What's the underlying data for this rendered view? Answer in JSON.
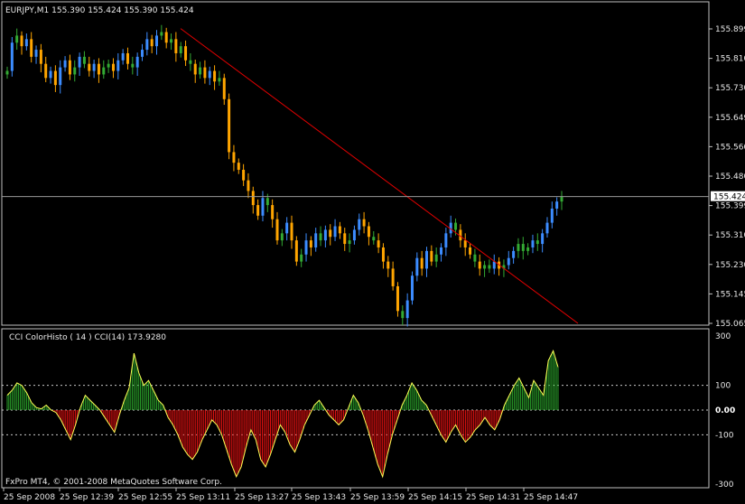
{
  "window": {
    "symbol_caption": "EURJPY,M1  155.390 155.424 155.390 155.424",
    "indicator_caption": "CCI ColorHisto ( 14 )   CCI(14) 173.9280",
    "copyright": "FxPro MT4, © 2001-2008 MetaQuotes Software Corp."
  },
  "colors": {
    "background": "#000000",
    "frame": "#c0c0c0",
    "bull_candle": "#3c8cff",
    "bear_candle": "#ffa500",
    "neutral_bar": "#33aa33",
    "trend_line": "#e00000",
    "cci_line": "#ffff55",
    "cci_pos_histo": "#2aa02a",
    "cci_neg_histo": "#e01010",
    "current_price_line": "#9a9a9a"
  },
  "chart_data": [
    {
      "type": "candlestick",
      "title": "EURJPY,M1",
      "price_labels": [
        "155.899",
        "155.810",
        "155.730",
        "155.649",
        "155.560",
        "155.480",
        "155.399",
        "155.310",
        "155.230",
        "155.145",
        "155.065"
      ],
      "current_price_label": "155.424",
      "ylim": [
        155.065,
        155.899
      ],
      "current_price": 155.424,
      "trend_line": {
        "from_time": "13:12",
        "from_price": 155.9,
        "to_time": "14:58",
        "to_price": 155.065
      },
      "series_close": [
        155.78,
        155.86,
        155.88,
        155.85,
        155.87,
        155.82,
        155.84,
        155.8,
        155.76,
        155.78,
        155.74,
        155.79,
        155.81,
        155.77,
        155.79,
        155.82,
        155.8,
        155.78,
        155.8,
        155.77,
        155.79,
        155.8,
        155.78,
        155.81,
        155.83,
        155.8,
        155.79,
        155.82,
        155.84,
        155.87,
        155.85,
        155.88,
        155.89,
        155.86,
        155.87,
        155.83,
        155.85,
        155.81,
        155.8,
        155.77,
        155.79,
        155.76,
        155.78,
        155.75,
        155.76,
        155.7,
        155.55,
        155.52,
        155.5,
        155.47,
        155.44,
        155.4,
        155.37,
        155.42,
        155.4,
        155.36,
        155.3,
        155.32,
        155.35,
        155.3,
        155.24,
        155.26,
        155.3,
        155.28,
        155.32,
        155.3,
        155.33,
        155.31,
        155.34,
        155.32,
        155.29,
        155.3,
        155.33,
        155.36,
        155.34,
        155.31,
        155.3,
        155.28,
        155.24,
        155.22,
        155.17,
        155.1,
        155.08,
        155.13,
        155.2,
        155.25,
        155.22,
        155.27,
        155.24,
        155.26,
        155.28,
        155.32,
        155.35,
        155.33,
        155.3,
        155.28,
        155.26,
        155.24,
        155.22,
        155.23,
        155.22,
        155.24,
        155.22,
        155.23,
        155.25,
        155.27,
        155.29,
        155.27,
        155.28,
        155.3,
        155.29,
        155.32,
        155.35,
        155.39,
        155.41,
        155.424
      ],
      "x_tick_labels": [
        "25 Sep 2008",
        "25 Sep 12:39",
        "25 Sep 12:55",
        "25 Sep 13:11",
        "25 Sep 13:27",
        "25 Sep 13:43",
        "25 Sep 13:59",
        "25 Sep 14:15",
        "25 Sep 14:31",
        "25 Sep 14:47"
      ]
    },
    {
      "type": "line+histogram",
      "title": "CCI ColorHisto ( 14 )",
      "ylim": [
        -300,
        300
      ],
      "levels": [
        100,
        0,
        -100
      ],
      "level_labels": [
        "300",
        "100",
        "0.00",
        "-100",
        "-300"
      ],
      "current_value": 173.928,
      "series_values": [
        60,
        80,
        110,
        100,
        70,
        30,
        10,
        5,
        20,
        0,
        -10,
        -40,
        -80,
        -120,
        -60,
        10,
        60,
        40,
        20,
        0,
        -30,
        -60,
        -90,
        -20,
        40,
        90,
        230,
        150,
        100,
        120,
        80,
        40,
        20,
        -30,
        -60,
        -100,
        -150,
        -180,
        -200,
        -170,
        -120,
        -80,
        -40,
        -60,
        -100,
        -160,
        -220,
        -270,
        -230,
        -150,
        -80,
        -120,
        -200,
        -230,
        -180,
        -120,
        -60,
        -90,
        -140,
        -170,
        -120,
        -60,
        -20,
        20,
        40,
        10,
        -20,
        -40,
        -60,
        -40,
        10,
        60,
        30,
        -20,
        -80,
        -150,
        -220,
        -270,
        -180,
        -100,
        -40,
        20,
        60,
        110,
        80,
        40,
        20,
        -20,
        -60,
        -100,
        -130,
        -90,
        -60,
        -100,
        -130,
        -110,
        -80,
        -60,
        -30,
        -60,
        -80,
        -40,
        20,
        60,
        100,
        130,
        90,
        50,
        120,
        90,
        60,
        200,
        240,
        173.928
      ],
      "x_tick_labels": [
        "25 Sep 2008",
        "25 Sep 12:39",
        "25 Sep 12:55",
        "25 Sep 13:11",
        "25 Sep 13:27",
        "25 Sep 13:43",
        "25 Sep 13:59",
        "25 Sep 14:15",
        "25 Sep 14:31",
        "25 Sep 14:47"
      ]
    }
  ]
}
